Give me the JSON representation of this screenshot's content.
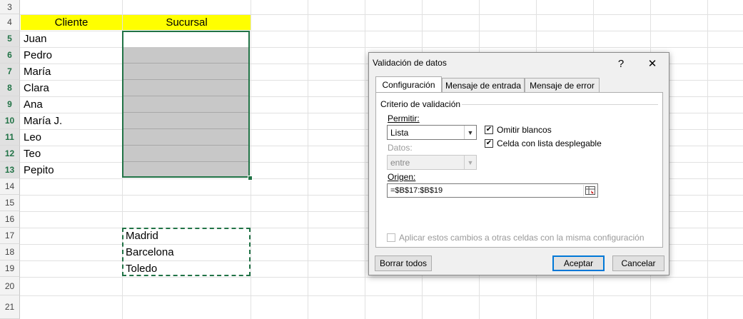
{
  "sheet": {
    "rows": [
      "3",
      "4",
      "5",
      "6",
      "7",
      "8",
      "9",
      "10",
      "11",
      "12",
      "13",
      "14",
      "15",
      "16",
      "17",
      "18",
      "19",
      "20",
      "21"
    ],
    "headers": {
      "cliente": "Cliente",
      "sucursal": "Sucursal"
    },
    "clients": [
      "Juan",
      "Pedro",
      "María",
      "Clara",
      "Ana",
      "María J.",
      "Leo",
      "Teo",
      "Pepito"
    ],
    "branches": [
      "Madrid",
      "Barcelona",
      "Toledo"
    ],
    "header_color": "#ffff00",
    "selection_color": "#217346"
  },
  "dialog": {
    "title": "Validación de datos",
    "help_label": "?",
    "close_label": "✕",
    "tabs": [
      "Configuración",
      "Mensaje de entrada",
      "Mensaje de error"
    ],
    "criteria_label": "Criterio de validación",
    "allow_label": "Permitir:",
    "allow_value": "Lista",
    "data_label": "Datos:",
    "data_value": "entre",
    "ignore_blank_label": "Omitir blancos",
    "ignore_blank_checked": true,
    "dropdown_label": "Celda con lista desplegable",
    "dropdown_checked": true,
    "source_label": "Origen:",
    "source_value": "=$B$17:$B$19",
    "apply_all_label": "Aplicar estos cambios a otras celdas con la misma configuración",
    "clear_all_label": "Borrar todos",
    "ok_label": "Aceptar",
    "cancel_label": "Cancelar"
  }
}
